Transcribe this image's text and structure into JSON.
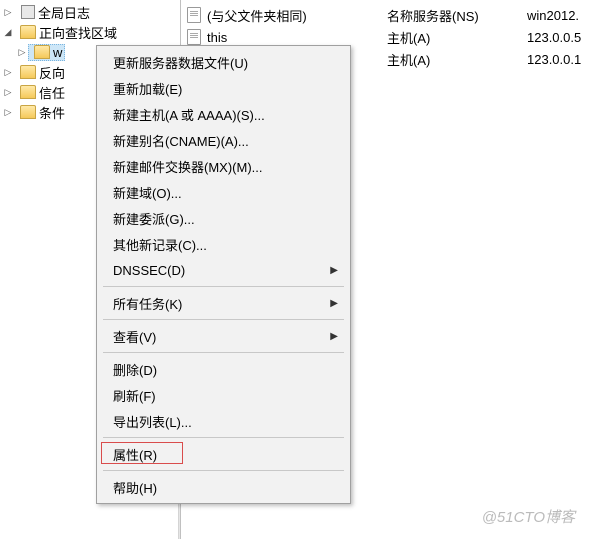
{
  "tree": {
    "items": [
      {
        "label": "全局日志",
        "expanded": false,
        "icon": "log",
        "indent": 0
      },
      {
        "label": "正向查找区域",
        "expanded": true,
        "icon": "folder",
        "indent": 0
      },
      {
        "label": "w",
        "expanded": false,
        "icon": "folder",
        "indent": 1,
        "selected": true
      },
      {
        "label": "反向",
        "expanded": false,
        "icon": "folder",
        "indent": 0
      },
      {
        "label": "信任",
        "expanded": false,
        "icon": "folder",
        "indent": 0
      },
      {
        "label": "条件",
        "expanded": false,
        "icon": "folder",
        "indent": 0
      }
    ]
  },
  "records": [
    {
      "name": "(与父文件夹相同)",
      "type": "名称服务器(NS)",
      "data": "win2012."
    },
    {
      "name": "this",
      "type": "主机(A)",
      "data": "123.0.0.5"
    },
    {
      "name": "",
      "type": "主机(A)",
      "data": "123.0.0.1"
    }
  ],
  "menu": {
    "groups": [
      [
        {
          "label": "更新服务器数据文件(U)",
          "sub": false
        },
        {
          "label": "重新加载(E)",
          "sub": false
        },
        {
          "label": "新建主机(A 或 AAAA)(S)...",
          "sub": false
        },
        {
          "label": "新建别名(CNAME)(A)...",
          "sub": false
        },
        {
          "label": "新建邮件交换器(MX)(M)...",
          "sub": false
        },
        {
          "label": "新建域(O)...",
          "sub": false
        },
        {
          "label": "新建委派(G)...",
          "sub": false
        },
        {
          "label": "其他新记录(C)...",
          "sub": false
        },
        {
          "label": "DNSSEC(D)",
          "sub": true
        }
      ],
      [
        {
          "label": "所有任务(K)",
          "sub": true
        }
      ],
      [
        {
          "label": "查看(V)",
          "sub": true
        }
      ],
      [
        {
          "label": "删除(D)",
          "sub": false
        },
        {
          "label": "刷新(F)",
          "sub": false
        },
        {
          "label": "导出列表(L)...",
          "sub": false
        }
      ],
      [
        {
          "label": "属性(R)",
          "sub": false,
          "highlight": true
        }
      ],
      [
        {
          "label": "帮助(H)",
          "sub": false
        }
      ]
    ]
  },
  "watermark": "@51CTO博客"
}
